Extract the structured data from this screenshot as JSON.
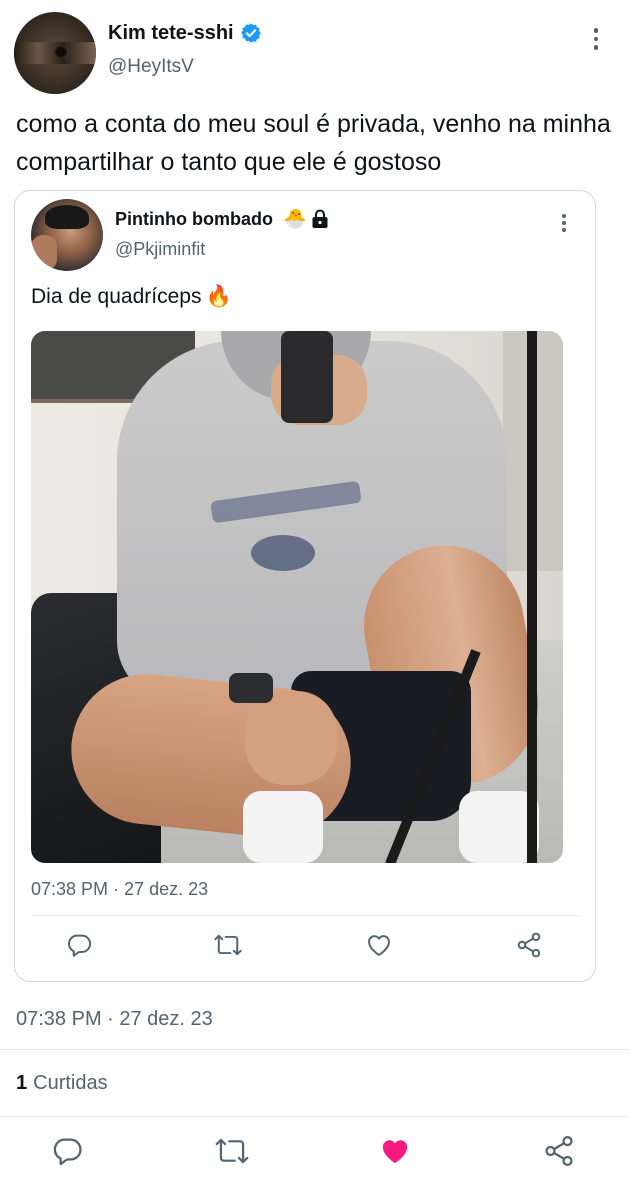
{
  "tweet": {
    "author_name": "Kim tete-sshi",
    "author_handle": "@HeyItsV",
    "text": "como a conta do meu soul é privada, venho na minha compartilhar o tanto que ele é gostoso",
    "timestamp": "07:38 PM · 27 dez. 23",
    "likes_count": "1",
    "likes_label": "Curtidas",
    "liked": true
  },
  "quoted_tweet": {
    "author_name": "Pintinho bombado",
    "author_emoji": "🐣",
    "author_handle": "@Pkjiminfit",
    "text": "Dia de quadríceps",
    "text_emoji": "🔥",
    "timestamp": "07:38 PM · 27 dez. 23"
  },
  "icons": {
    "verified": "verified-badge-icon",
    "lock": "lock-icon",
    "reply": "reply-icon",
    "retweet": "retweet-icon",
    "like": "heart-icon",
    "share": "share-icon",
    "more": "more-vertical-icon"
  },
  "colors": {
    "text_primary": "#0f1419",
    "text_secondary": "#536471",
    "verified_blue": "#1d9bf0",
    "like_active": "#f91880",
    "border": "#cfd9de"
  }
}
